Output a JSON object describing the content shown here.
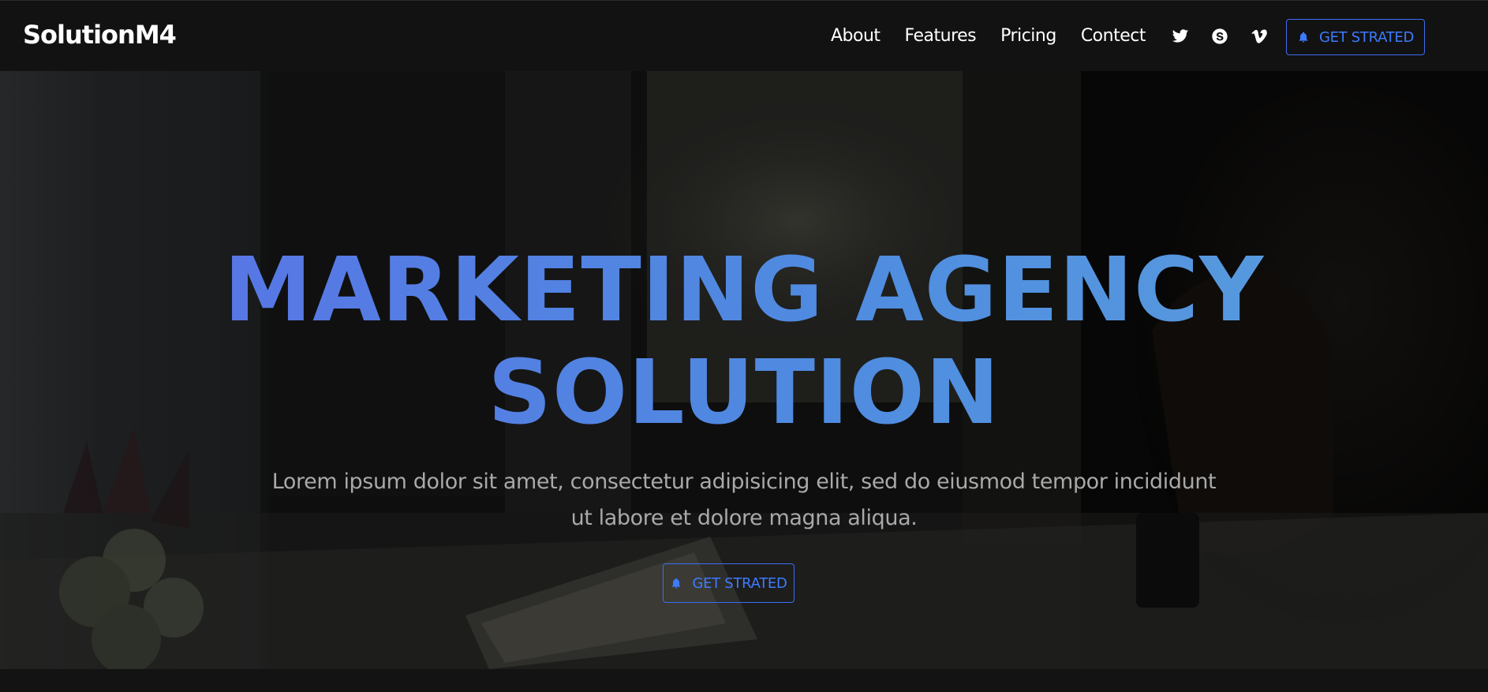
{
  "brand": "SolutionM4",
  "nav": {
    "links": [
      "About",
      "Features",
      "Pricing",
      "Contect"
    ],
    "social": [
      "twitter-icon",
      "skype-icon",
      "vimeo-icon"
    ],
    "cta_label": "GET STRATED"
  },
  "hero": {
    "title_line1": "MARKETING AGENCY",
    "title_line2": "SOLUTION",
    "subtitle": "Lorem ipsum dolor sit amet, consectetur adipisicing elit, sed do eiusmod tempor incididunt ut labore et dolore magna aliqua.",
    "cta_label": "GET STRATED"
  },
  "colors": {
    "accent": "#3d7bff",
    "navbar_bg": "#121212",
    "title_gradient_start": "#5a6fe6",
    "title_gradient_end": "#5aa0dd"
  }
}
